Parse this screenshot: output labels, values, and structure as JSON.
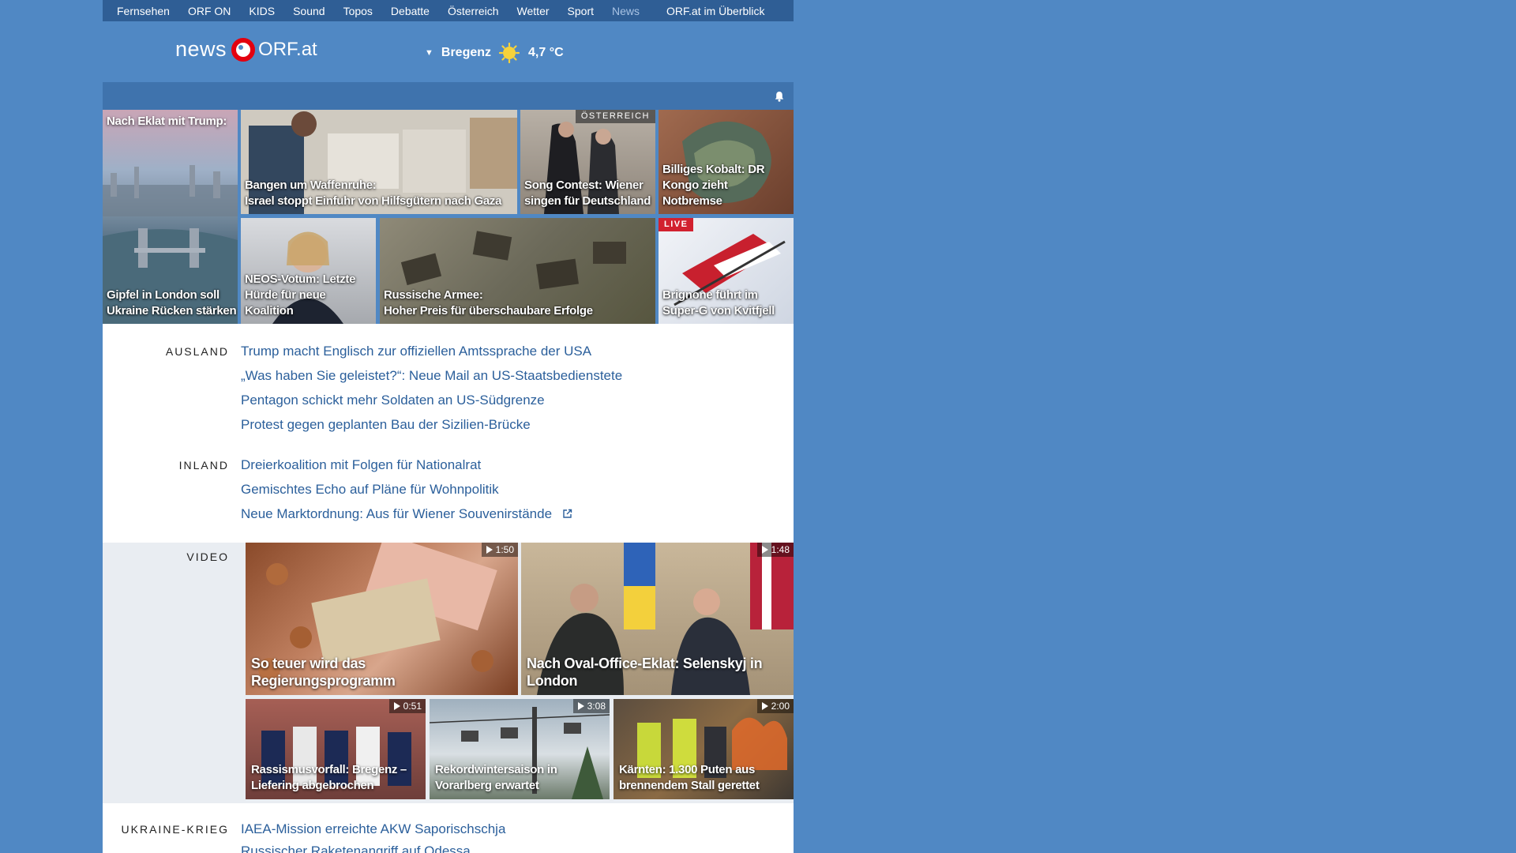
{
  "topnav": {
    "items": [
      "Fernsehen",
      "ORF ON",
      "KIDS",
      "Sound",
      "Topos",
      "Debatte",
      "Österreich",
      "Wetter",
      "Sport",
      "News"
    ],
    "current": "News",
    "overview": "ORF.at im Überblick"
  },
  "header": {
    "logo_news": "news",
    "logo_orf": "ORF.at",
    "weather": {
      "location": "Bregenz",
      "temperature": "4,7 °C",
      "icon": "sun-icon"
    }
  },
  "notification": {
    "icon": "bell-icon"
  },
  "tiles": {
    "london": {
      "top": "Nach Eklat mit Trump:",
      "caption": "Gipfel in London soll Ukraine Rücken stärken"
    },
    "gaza": {
      "caption_1": "Bangen um Waffenruhe:",
      "caption_2": "Israel stoppt Einfuhr von Hilfsgütern nach Gaza"
    },
    "songcontest": {
      "badge": "ÖSTERREICH",
      "caption_1": "Song Contest: Wiener",
      "caption_2": "singen für Deutschland"
    },
    "kobalt": {
      "caption_1": "Billiges Kobalt: DR",
      "caption_2": "Kongo zieht Notbremse"
    },
    "neos": {
      "caption_1": "NEOS-Votum: Letzte",
      "caption_2": "Hürde für neue Koalition"
    },
    "armee": {
      "caption_1": "Russische Armee:",
      "caption_2": "Hoher Preis für überschaubare Erfolge"
    },
    "brignone": {
      "badge": "LIVE",
      "caption_1": "Brignone führt im",
      "caption_2": "Super-G von Kvitfjell"
    }
  },
  "sections": {
    "ausland": {
      "label": "AUSLAND",
      "items": [
        "Trump macht Englisch zur offiziellen Amtssprache der USA",
        "„Was haben Sie geleistet?“: Neue Mail an US-Staatsbedienstete",
        "Pentagon schickt mehr Soldaten an US-Südgrenze",
        "Protest gegen geplanten Bau der Sizilien-Brücke"
      ]
    },
    "inland": {
      "label": "INLAND",
      "items": [
        "Dreierkoalition mit Folgen für Nationalrat",
        "Gemischtes Echo auf Pläne für Wohnpolitik",
        "Neue Marktordnung: Aus für Wiener Souvenirstände"
      ]
    },
    "video": {
      "label": "VIDEO",
      "items": [
        {
          "caption": "So teuer wird das Regierungsprogramm",
          "duration": "1:50"
        },
        {
          "caption": "Nach Oval-Office-Eklat: Selenskyj in London",
          "duration": "1:48"
        },
        {
          "caption": "Rassismusvorfall: Bregenz – Liefering abgebrochen",
          "duration": "0:51"
        },
        {
          "caption": "Rekordwintersaison in Vorarlberg erwartet",
          "duration": "3:08"
        },
        {
          "caption": "Kärnten: 1.300 Puten aus brennendem Stall gerettet",
          "duration": "2:00"
        }
      ]
    },
    "ukraine": {
      "label": "UKRAINE-KRIEG",
      "items": [
        "IAEA-Mission erreichte AKW Saporischschja",
        "Russischer Raketenangriff auf Odessa"
      ]
    }
  },
  "colors": {
    "page_bg": "#5088c4",
    "nav_bg": "#2f5e95",
    "link": "#2b5f9b",
    "live": "#d2212f",
    "orf_red": "#e3000f"
  }
}
